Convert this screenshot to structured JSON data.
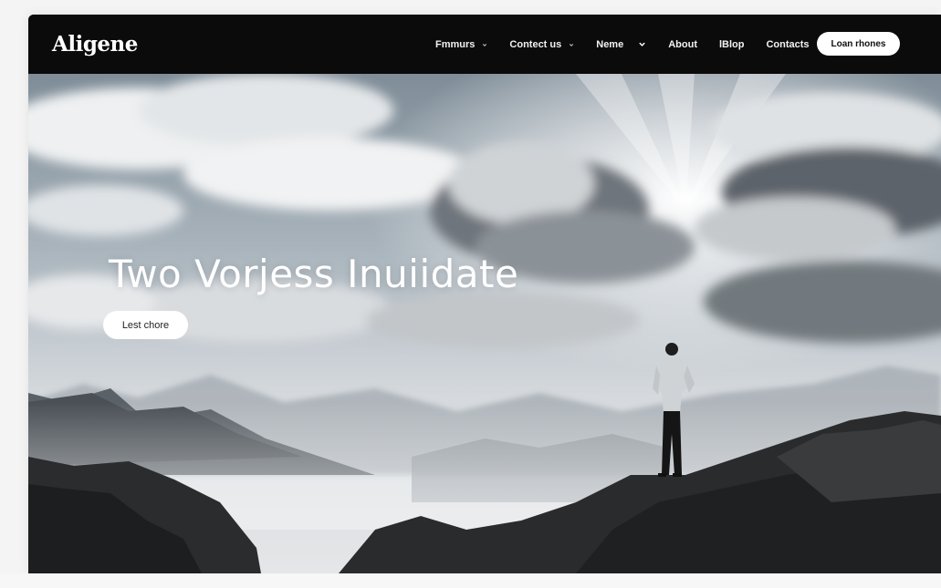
{
  "brand": {
    "logo_text": "Aligene"
  },
  "nav": {
    "items": [
      {
        "label": "Fmmurs",
        "has_dropdown": true
      },
      {
        "label": "Contect us",
        "has_dropdown": true
      },
      {
        "label": "Neme",
        "has_dropdown": true
      },
      {
        "label": "About",
        "has_dropdown": false
      },
      {
        "label": "lBlop",
        "has_dropdown": false
      },
      {
        "label": "Contacts",
        "has_dropdown": false
      }
    ],
    "cta_label": "Loan rhones"
  },
  "hero": {
    "headline": "Two Vorjess Inuiidate",
    "button_label": "Lest chore"
  },
  "colors": {
    "navbar_bg": "#0b0b0b",
    "button_bg": "#ffffff",
    "text_light": "#ffffff"
  },
  "icons": {
    "dropdown": "chevron-down-icon"
  }
}
